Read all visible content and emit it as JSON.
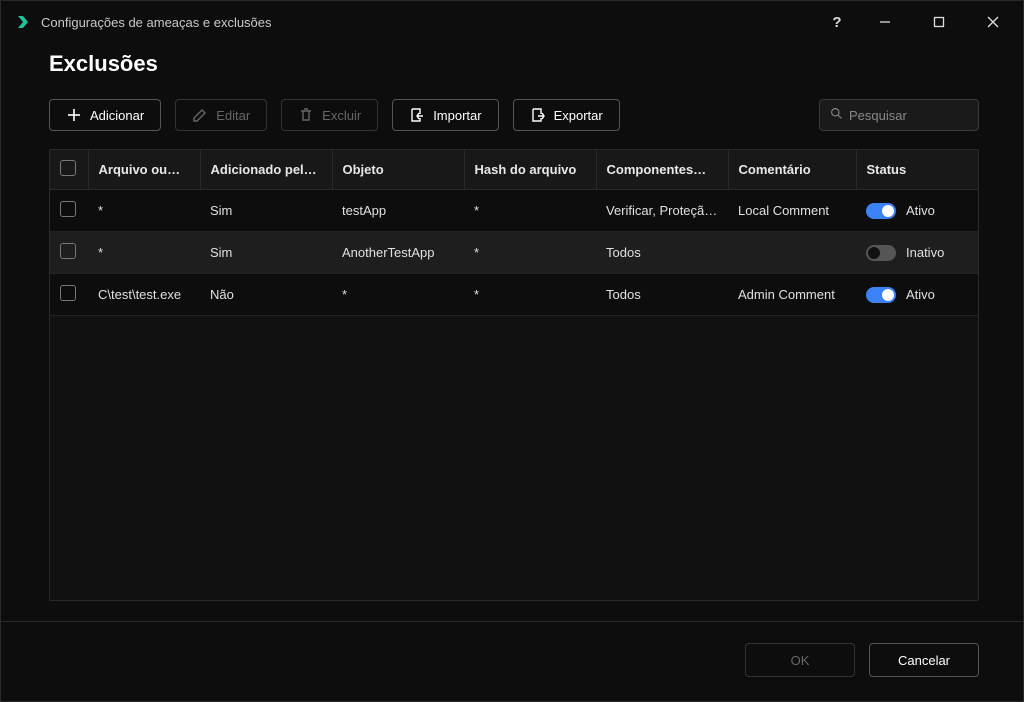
{
  "window": {
    "title": "Configurações de ameaças e exclusões"
  },
  "page": {
    "heading": "Exclusões"
  },
  "toolbar": {
    "add": "Adicionar",
    "edit": "Editar",
    "delete": "Excluir",
    "import": "Importar",
    "export": "Exportar"
  },
  "search": {
    "placeholder": "Pesquisar"
  },
  "table": {
    "headers": {
      "file": "Arquivo ou…",
      "added": "Adicionado pel…",
      "object": "Objeto",
      "hash": "Hash do arquivo",
      "components": "Componentes…",
      "comment": "Comentário",
      "status": "Status"
    },
    "rows": [
      {
        "file": "*",
        "added": "Sim",
        "object": "testApp",
        "hash": "*",
        "components": "Verificar, Proteçã…",
        "comment": "Local Comment",
        "status_on": true,
        "status_label": "Ativo"
      },
      {
        "file": "*",
        "added": "Sim",
        "object": "AnotherTestApp",
        "hash": "*",
        "components": "Todos",
        "comment": "",
        "status_on": false,
        "status_label": "Inativo"
      },
      {
        "file": "C\\test\\test.exe",
        "added": "Não",
        "object": "*",
        "hash": "*",
        "components": "Todos",
        "comment": "Admin Comment",
        "status_on": true,
        "status_label": "Ativo"
      }
    ]
  },
  "footer": {
    "ok": "OK",
    "cancel": "Cancelar"
  }
}
